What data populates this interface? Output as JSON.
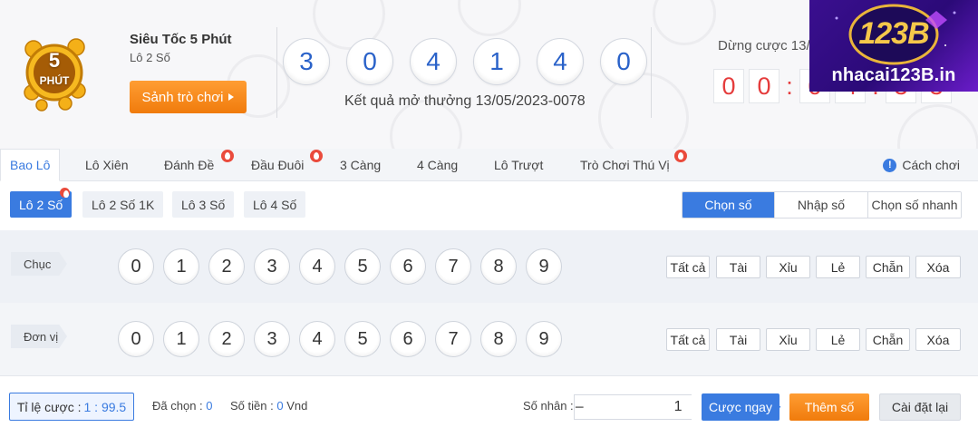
{
  "game": {
    "logo_big": "5",
    "logo_small": "PHÚT",
    "title": "Siêu Tốc 5 Phút",
    "subtitle": "Lô 2 Số",
    "lobby_button": "Sảnh trò chơi"
  },
  "result": {
    "balls": [
      "3",
      "0",
      "4",
      "1",
      "4",
      "0"
    ],
    "caption": "Kết quả mở thưởng 13/05/2023-0078"
  },
  "countdown": {
    "label": "Dừng cược 13/",
    "digits": [
      "0",
      "0",
      "0",
      "4",
      "3",
      "3"
    ],
    "separator": ":"
  },
  "brand": {
    "logo_text": "123B",
    "site": "nhacai123B.in"
  },
  "tabs": [
    {
      "label": "Bao Lô",
      "active": true,
      "hot": false
    },
    {
      "label": "Lô Xiên",
      "active": false,
      "hot": false
    },
    {
      "label": "Đánh Đề",
      "active": false,
      "hot": true
    },
    {
      "label": "Đầu Đuôi",
      "active": false,
      "hot": true
    },
    {
      "label": "3 Càng",
      "active": false,
      "hot": false
    },
    {
      "label": "4 Càng",
      "active": false,
      "hot": false
    },
    {
      "label": "Lô Trượt",
      "active": false,
      "hot": false
    },
    {
      "label": "Trò Chơi Thú Vị",
      "active": false,
      "hot": true
    }
  ],
  "howto": {
    "icon": "!",
    "label": "Cách chơi"
  },
  "subtabs": [
    {
      "label": "Lô 2 Số",
      "active": true
    },
    {
      "label": "Lô 2 Số 1K",
      "active": false
    },
    {
      "label": "Lô 3 Số",
      "active": false
    },
    {
      "label": "Lô 4 Số",
      "active": false
    }
  ],
  "modes": [
    {
      "label": "Chọn số",
      "active": true
    },
    {
      "label": "Nhập số",
      "active": false
    },
    {
      "label": "Chọn số nhanh",
      "active": false
    }
  ],
  "rows": [
    {
      "label": "Chục",
      "numbers": [
        "0",
        "1",
        "2",
        "3",
        "4",
        "5",
        "6",
        "7",
        "8",
        "9"
      ]
    },
    {
      "label": "Đơn vị",
      "numbers": [
        "0",
        "1",
        "2",
        "3",
        "4",
        "5",
        "6",
        "7",
        "8",
        "9"
      ]
    }
  ],
  "quick_buttons": [
    "Tất cả",
    "Tài",
    "Xỉu",
    "Lẻ",
    "Chẵn",
    "Xóa"
  ],
  "footer": {
    "ratio_label": "Tỉ lệ cược :",
    "ratio_value": "1 : 99.5",
    "selected_label": "Đã chọn :",
    "selected_value": "0",
    "amount_label": "Số tiền :",
    "amount_value": "0",
    "amount_unit": "Vnd",
    "multiplier_label": "Số nhân :",
    "multiplier_value": "1",
    "minus": "−",
    "plus": "+",
    "bet_button": "Cược ngay",
    "add_button": "Thêm số",
    "reset_button": "Cài đặt lại"
  },
  "colors": {
    "accent": "#3a7be0",
    "orange": "#f07b0c",
    "timer_red": "#e53c3c",
    "ball_blue": "#2a62c9"
  }
}
